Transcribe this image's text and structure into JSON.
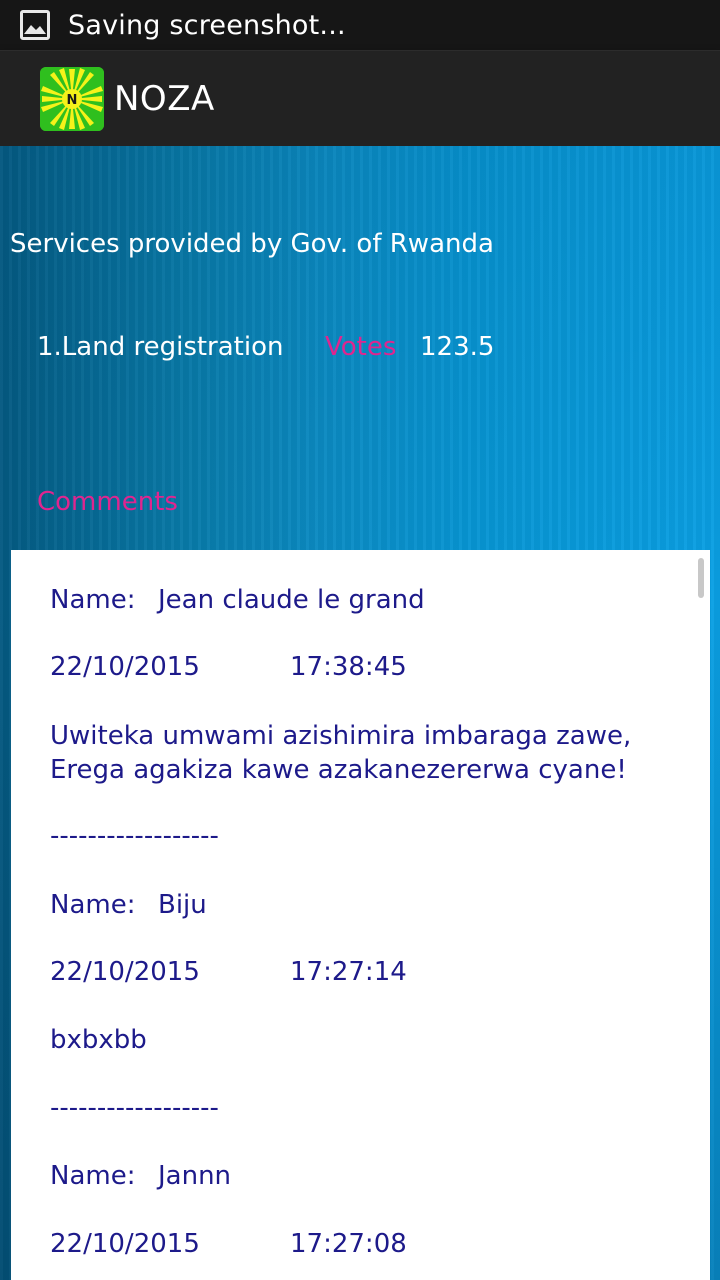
{
  "status_bar": {
    "notification_icon": "image-icon",
    "text": "Saving screenshot..."
  },
  "action_bar": {
    "logo_icon": "noza-logo-icon",
    "logo_letter": "N",
    "title": "NOZA"
  },
  "page": {
    "title": "Services provided by Gov. of Rwanda",
    "service": {
      "name": "1.Land registration",
      "votes_label": "Votes",
      "votes_value": "123.5"
    },
    "comments_heading": "Comments"
  },
  "colors": {
    "accent_magenta": "#e0258f",
    "comment_text": "#1d1a8a",
    "logo_green": "#2fbf1e",
    "logo_yellow": "#f5f21a"
  },
  "comments": [
    {
      "name_label": "Name:",
      "name": "Jean claude le grand",
      "date": "22/10/2015",
      "time": "17:38:45",
      "text": "Uwiteka umwami azishimira imbaraga zawe, Erega agakiza kawe azakanezererwa cyane!",
      "separator": "------------------"
    },
    {
      "name_label": "Name:",
      "name": "Biju",
      "date": "22/10/2015",
      "time": "17:27:14",
      "text": "bxbxbb",
      "separator": "------------------"
    },
    {
      "name_label": "Name:",
      "name": "Jannn",
      "date": "22/10/2015",
      "time": "17:27:08"
    }
  ]
}
